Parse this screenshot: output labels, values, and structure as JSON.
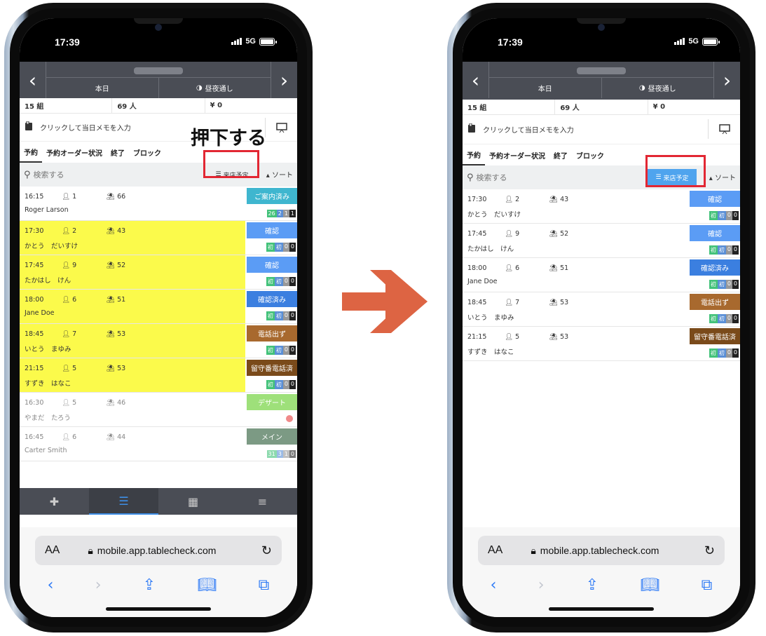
{
  "status": {
    "time": "17:39",
    "network": "5G"
  },
  "header": {
    "today": "本日",
    "daynight": "昼夜通し",
    "prev_icon": "chevron-left-icon",
    "next_icon": "chevron-right-icon"
  },
  "stats": {
    "groups": "15 組",
    "people": "69 人",
    "amount": "¥ 0"
  },
  "memo": {
    "placeholder": "クリックして当日メモを入力"
  },
  "tabs": [
    "予約",
    "予約オーダー状況",
    "終了",
    "ブロック"
  ],
  "search": {
    "placeholder": "検索する",
    "visit_label": "来店予定",
    "sort_label": "ソート"
  },
  "annotation": {
    "caption": "押下する"
  },
  "left_rows": [
    {
      "time": "16:15",
      "people": "1",
      "seats": "66",
      "name": "Roger Larson",
      "status": "ご案内済み",
      "status_color": "#3fb6cf",
      "badges": [
        "26",
        "2",
        "1",
        "1"
      ],
      "highlight": false,
      "muted": false
    },
    {
      "time": "17:30",
      "people": "2",
      "seats": "43",
      "name": "かとう　だいすけ",
      "status": "確認",
      "status_color": "#5b9cf5",
      "badges": [
        "初",
        "初",
        "0",
        "0"
      ],
      "highlight": true,
      "muted": false
    },
    {
      "time": "17:45",
      "people": "9",
      "seats": "52",
      "name": "たかはし　けん",
      "status": "確認",
      "status_color": "#5b9cf5",
      "badges": [
        "初",
        "初",
        "0",
        "0"
      ],
      "highlight": true,
      "muted": false
    },
    {
      "time": "18:00",
      "people": "6",
      "seats": "51",
      "name": "Jane Doe",
      "status": "確認済み",
      "status_color": "#3b7fe0",
      "badges": [
        "初",
        "初",
        "0",
        "0"
      ],
      "highlight": true,
      "muted": false
    },
    {
      "time": "18:45",
      "people": "7",
      "seats": "53",
      "name": "いとう　まゆみ",
      "status": "電話出ず",
      "status_color": "#a8692e",
      "badges": [
        "初",
        "初",
        "0",
        "0"
      ],
      "highlight": true,
      "muted": false
    },
    {
      "time": "21:15",
      "people": "5",
      "seats": "53",
      "name": "すずき　はなこ",
      "status": "留守番電話済",
      "status_color": "#7a4a1a",
      "badges": [
        "初",
        "初",
        "0",
        "0"
      ],
      "highlight": true,
      "muted": false
    },
    {
      "time": "16:30",
      "people": "5",
      "seats": "46",
      "name": "やまだ　たろう",
      "status": "デザート",
      "status_color": "#9ee07a",
      "badges": [],
      "highlight": false,
      "muted": true
    },
    {
      "time": "16:45",
      "people": "6",
      "seats": "44",
      "name": "Carter Smith",
      "status": "メイン",
      "status_color": "#7c9a84",
      "badges": [
        "31",
        "3",
        "1",
        "0"
      ],
      "highlight": false,
      "muted": true
    }
  ],
  "right_rows": [
    {
      "time": "17:30",
      "people": "2",
      "seats": "43",
      "name": "かとう　だいすけ",
      "status": "確認",
      "status_color": "#5b9cf5",
      "badges": [
        "初",
        "初",
        "0",
        "0"
      ]
    },
    {
      "time": "17:45",
      "people": "9",
      "seats": "52",
      "name": "たかはし　けん",
      "status": "確認",
      "status_color": "#5b9cf5",
      "badges": [
        "初",
        "初",
        "0",
        "0"
      ]
    },
    {
      "time": "18:00",
      "people": "6",
      "seats": "51",
      "name": "Jane Doe",
      "status": "確認済み",
      "status_color": "#3b7fe0",
      "badges": [
        "初",
        "初",
        "0",
        "0"
      ]
    },
    {
      "time": "18:45",
      "people": "7",
      "seats": "53",
      "name": "いとう　まゆみ",
      "status": "電話出ず",
      "status_color": "#a8692e",
      "badges": [
        "初",
        "初",
        "0",
        "0"
      ]
    },
    {
      "time": "21:15",
      "people": "5",
      "seats": "53",
      "name": "すずき　はなこ",
      "status": "留守番電話済",
      "status_color": "#7a4a1a",
      "badges": [
        "初",
        "初",
        "0",
        "0"
      ]
    }
  ],
  "browser": {
    "aa": "AA",
    "url": "mobile.app.tablecheck.com"
  },
  "colors": {
    "accent_red": "#e22733",
    "arrow": "#dd6443",
    "visit_active": "#4fa4ee",
    "highlight": "#fbfa4b"
  }
}
